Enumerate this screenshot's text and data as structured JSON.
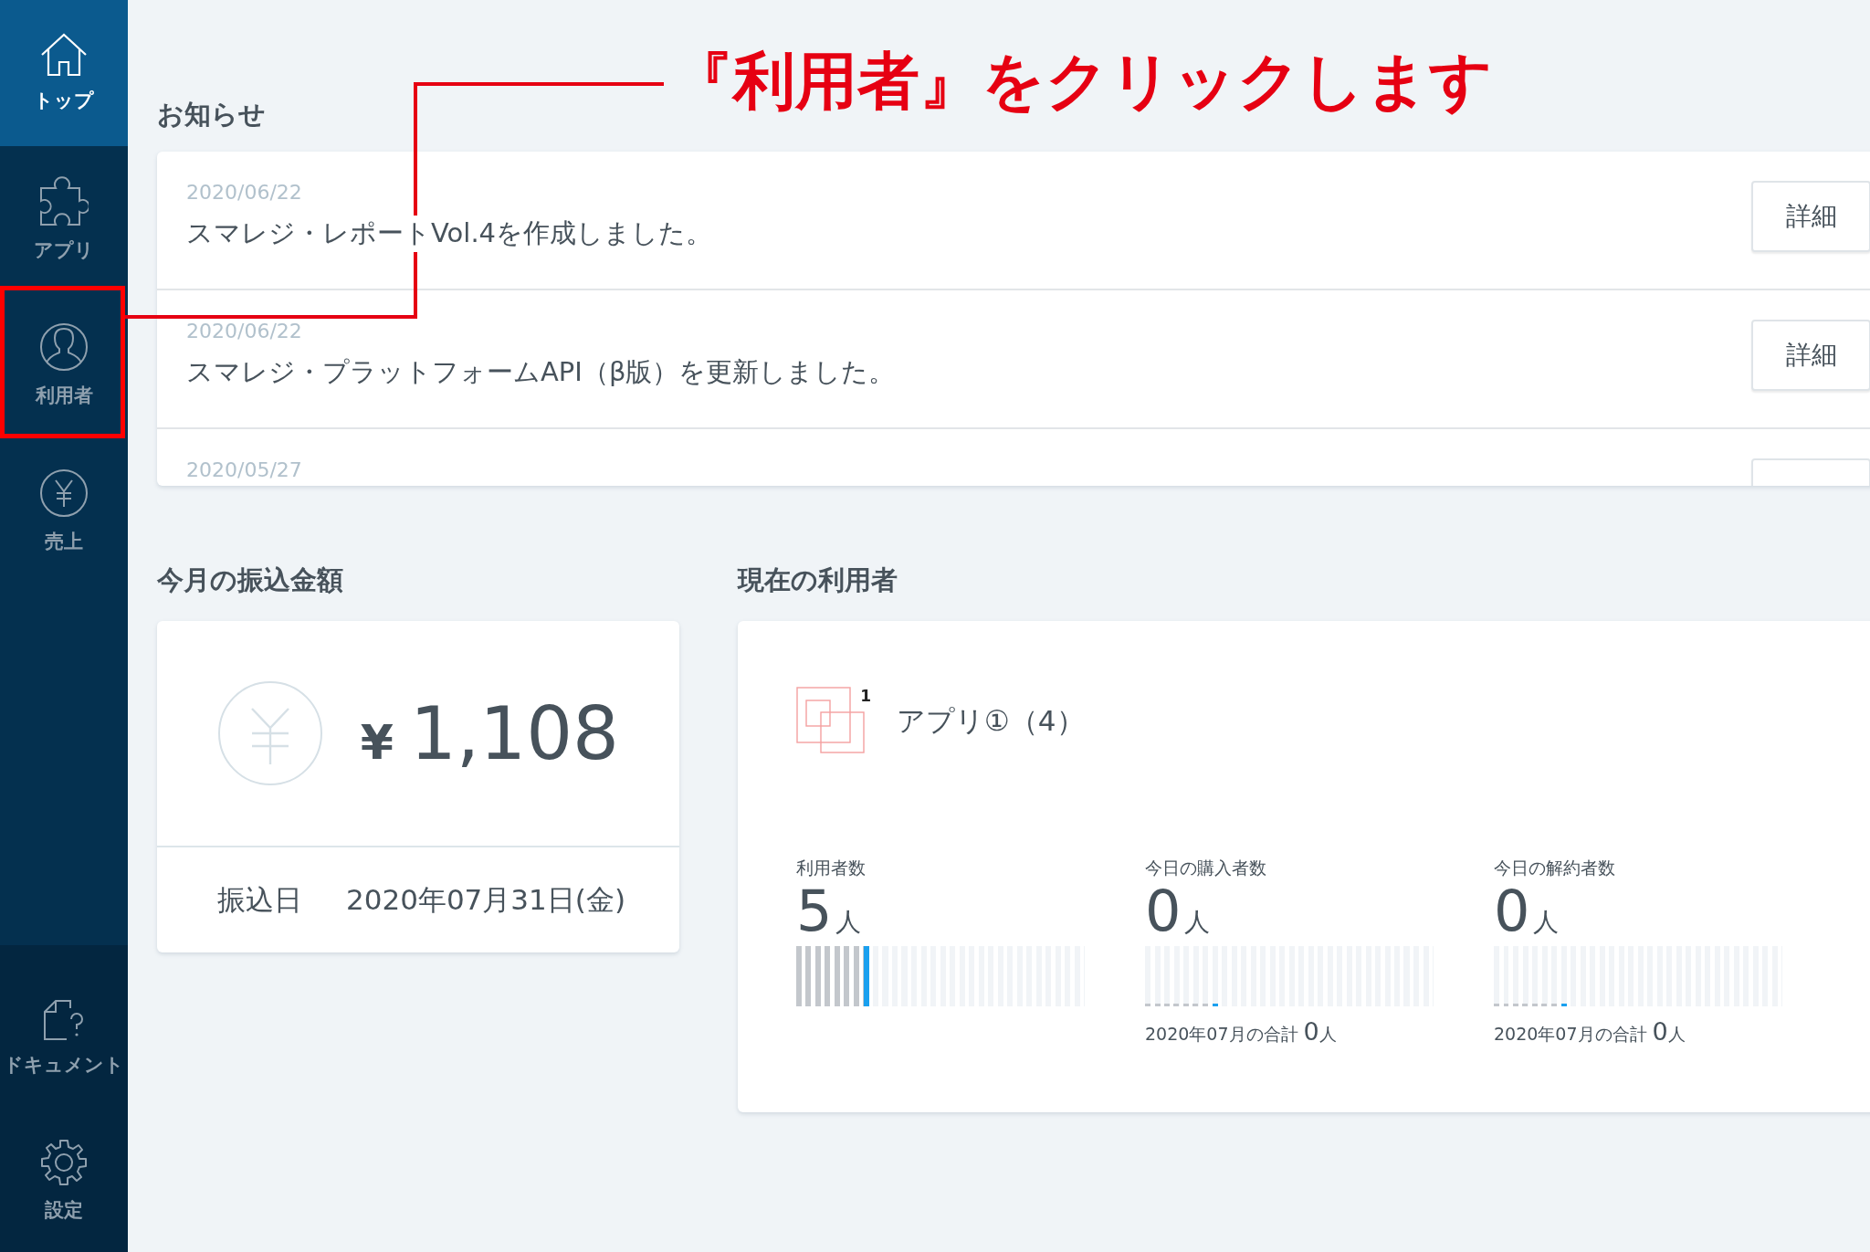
{
  "sidebar": {
    "items": [
      {
        "label": "トップ",
        "selected": true,
        "highlighted": false
      },
      {
        "label": "アプリ",
        "selected": false,
        "highlighted": false
      },
      {
        "label": "利用者",
        "selected": false,
        "highlighted": true
      },
      {
        "label": "売上",
        "selected": false,
        "highlighted": false
      }
    ],
    "bottom_items": [
      {
        "label": "ドキュメント",
        "selected": false
      },
      {
        "label": "設定",
        "selected": false
      }
    ]
  },
  "annotation": {
    "text": "『利用者』をクリックします"
  },
  "notices": {
    "title": "お知らせ",
    "items": [
      {
        "date": "2020/06/22",
        "text": "スマレジ・レポートVol.4を作成しました。",
        "button": "詳細"
      },
      {
        "date": "2020/06/22",
        "text": "スマレジ・プラットフォームAPI（β版）を更新しました。",
        "button": "詳細"
      },
      {
        "date": "2020/05/27"
      }
    ]
  },
  "transfer": {
    "title": "今月の振込金額",
    "currency": "¥",
    "amount": "1,108",
    "date_label": "振込日",
    "date": "2020年07月31日(金)"
  },
  "users": {
    "title": "現在の利用者",
    "app": {
      "name": "アプリ①（4）",
      "badge": "1"
    },
    "stats": [
      {
        "label": "利用者数",
        "value": "5",
        "unit": "人",
        "kind": "bars"
      },
      {
        "label": "今日の購入者数",
        "value": "0",
        "unit": "人",
        "kind": "baseline",
        "total_label": "2020年07月の合計",
        "total_value": "0",
        "total_unit": "人"
      },
      {
        "label": "今日の解約者数",
        "value": "0",
        "unit": "人",
        "kind": "baseline",
        "total_label": "2020年07月の合計",
        "total_value": "0",
        "total_unit": "人"
      }
    ]
  }
}
